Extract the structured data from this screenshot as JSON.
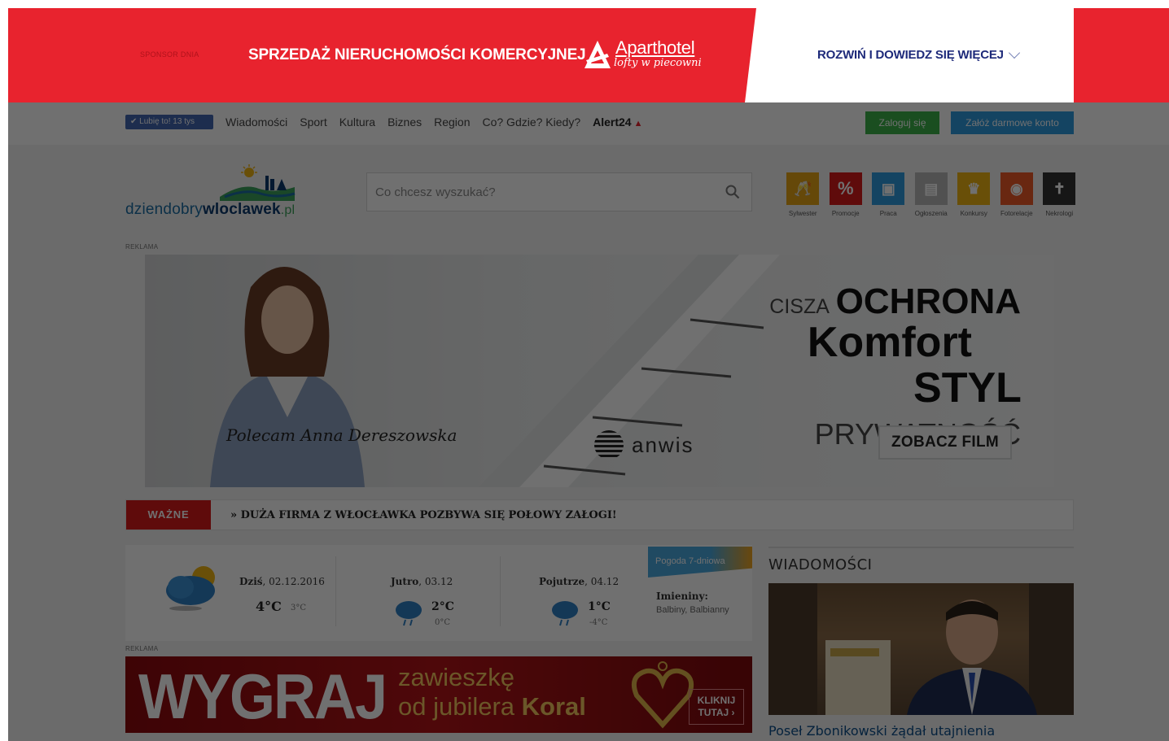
{
  "sponsor": {
    "label": "SPONSOR DNIA",
    "headline": "SPRZEDAŻ NIERUCHOMOŚCI KOMERCYJNEJ",
    "brand": "Aparthotel",
    "brand_sub": "lofty w piecowni",
    "cta": "ROZWIŃ I DOWIEDZ SIĘ WIĘCEJ",
    "color": "#e8232e"
  },
  "nav": {
    "like_label": "✔ Lubię to! 13 tys",
    "items": [
      "Wiadomości",
      "Sport",
      "Kultura",
      "Biznes",
      "Region",
      "Co? Gdzie? Kiedy?"
    ],
    "alert_label": "Alert24",
    "login": "Zaloguj się",
    "register": "Załóż darmowe konto"
  },
  "site": {
    "logo_prefix": "dziendobry",
    "logo_bold": "wloclawek",
    "logo_suffix": ".pl"
  },
  "search": {
    "placeholder": "Co chcesz wyszukać?"
  },
  "quick_links": [
    {
      "label": "Sylwester",
      "color": "#e6a415",
      "icon": "champagne-icon",
      "glyph": "🥂"
    },
    {
      "label": "Promocje",
      "color": "#d81b1b",
      "icon": "percent-icon",
      "glyph": "%"
    },
    {
      "label": "Praca",
      "color": "#2f9be0",
      "icon": "briefcase-icon",
      "glyph": "▣"
    },
    {
      "label": "Ogłoszenia",
      "color": "#b8b8b8",
      "icon": "document-icon",
      "glyph": "▤"
    },
    {
      "label": "Konkursy",
      "color": "#f0b414",
      "icon": "trophy-icon",
      "glyph": "♛"
    },
    {
      "label": "Fotorelacje",
      "color": "#f05a28",
      "icon": "camera-icon",
      "glyph": "◉"
    },
    {
      "label": "Nekrologi",
      "color": "#333333",
      "icon": "cross-icon",
      "glyph": "✝"
    }
  ],
  "ads": {
    "reklama": "REKLAMA",
    "banner": {
      "signature": "Polecam Anna Dereszowska",
      "brand": "anwis",
      "s1_light": "CISZA",
      "s1_bold": "OCHRONA",
      "s2": "Komfort",
      "s3_bold": "STYL",
      "s3_light": "PRYWATNOŚĆ",
      "cta": "ZOBACZ FILM"
    },
    "jewel": {
      "big": "WYGRAJ",
      "line1": "zawieszkę",
      "line2_a": "od jubilera",
      "line2_b": "Koral",
      "cta1": "KLIKNIJ",
      "cta2": "TUTAJ ›"
    }
  },
  "important": {
    "tag": "WAŻNE",
    "headline": "» DUŻA FIRMA Z WŁOCŁAWKA POZBYWA SIĘ POŁOWY ZAŁOGI!"
  },
  "weather": {
    "today_label": "Dziś",
    "today_date": ", 02.12.2016",
    "today_temp": "4°C",
    "today_low": "3°C",
    "tomorrow_label": "Jutro",
    "tomorrow_date": ", 03.12",
    "tomorrow_temp": "2°C",
    "tomorrow_low": "0°C",
    "after_label": "Pojutrze",
    "after_date": ", 04.12",
    "after_temp": "1°C",
    "after_low": "-4°C",
    "forecast_btn": "Pogoda 7-dniowa",
    "names_title": "Imieniny:",
    "names": "Balbiny, Balbianny"
  },
  "news": {
    "section_title": "WIADOMOŚCI",
    "headline": "Poseł Zbonikowski żądał utajnienia"
  }
}
